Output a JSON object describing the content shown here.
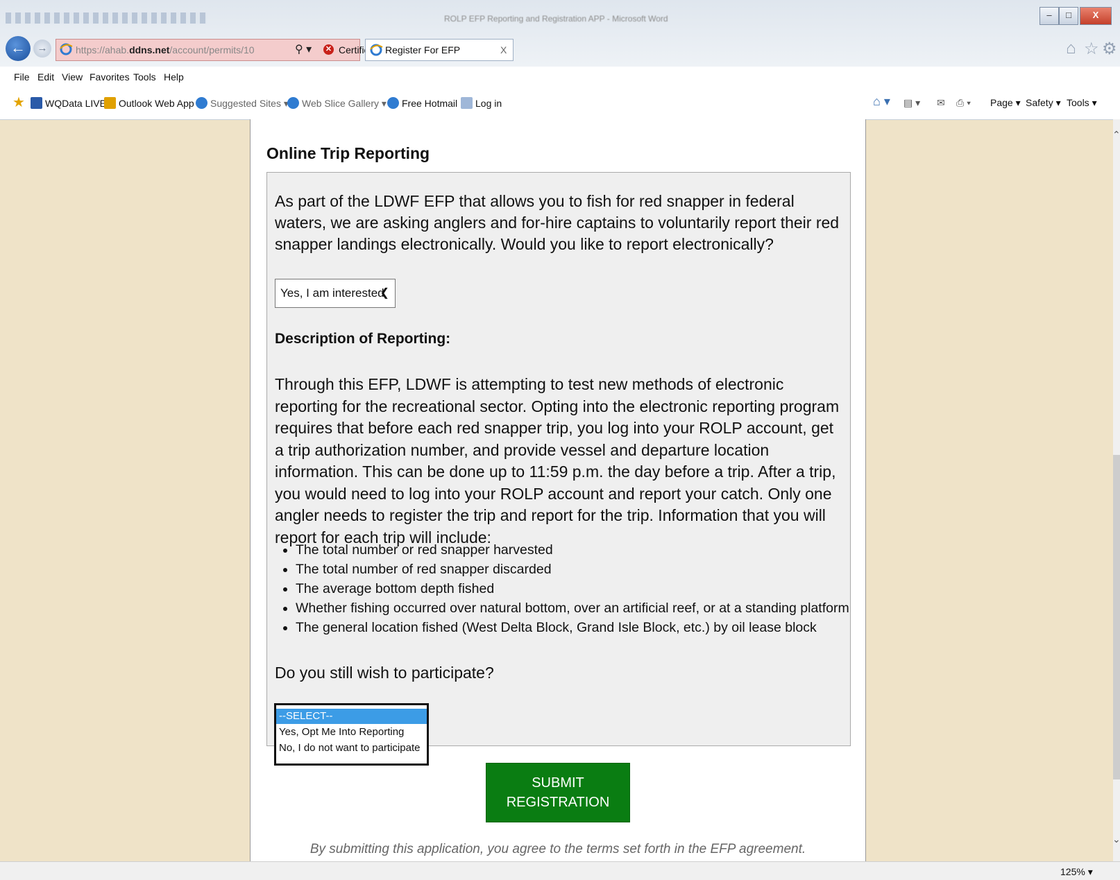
{
  "window": {
    "doc_title": "ROLP EFP Reporting and Registration APP - Microsoft Word",
    "min": "–",
    "max": "□",
    "close": "X"
  },
  "address_bar": {
    "url_prefix": "https://ahab.",
    "url_domain": "ddns.net",
    "url_path": "/account/permits/10",
    "search_icon": "⚲ ▾",
    "cert_error": "Certificate error",
    "refresh_icon": "↻"
  },
  "tab": {
    "title": "Register For EFP",
    "close": "X"
  },
  "menu": [
    "File",
    "Edit",
    "View",
    "Favorites",
    "Tools",
    "Help"
  ],
  "favorites": [
    {
      "label": "WQData LIVE",
      "color": "#2a5aa8"
    },
    {
      "label": "Outlook Web App",
      "color": "#e0a000"
    },
    {
      "label": "Suggested Sites ▾",
      "color": "#2f7bd1"
    },
    {
      "label": "Web Slice Gallery ▾",
      "color": "#2f7bd1"
    },
    {
      "label": "Free Hotmail",
      "color": "#2f7bd1"
    },
    {
      "label": "Log in",
      "color": "#9fb7d8"
    }
  ],
  "commands": {
    "page": "Page ▾",
    "safety": "Safety ▾",
    "tools": "Tools ▾"
  },
  "page": {
    "section_title": "Online Trip Reporting",
    "intro": "As part of the LDWF EFP that allows you to fish for red snapper in federal waters, we are asking anglers and for-hire captains to voluntarily report their red snapper landings electronically. Would you like to report electronically?",
    "interest_select": "Yes, I am interested",
    "desc_heading": "Description of Reporting:",
    "description": "Through this EFP, LDWF is attempting to test new methods of electronic reporting for the recreational sector. Opting into the electronic reporting program requires that before each red snapper trip, you log into your ROLP account, get a trip authorization number, and provide vessel and departure location information. This can be done up to 11:59 p.m. the day before a trip. After a trip, you would need to log into your ROLP account and report your catch. Only one angler needs to register the trip and report for the trip. Information that you will report for each trip will include:",
    "bullets": [
      "The total number or red snapper harvested",
      "The total number of red snapper discarded",
      "The average bottom depth fished",
      "Whether fishing occurred over natural bottom, over an artificial reef, or at a standing platform",
      "The general location fished (West Delta Block, Grand Isle Block, etc.) by oil lease block"
    ],
    "question": "Do you still wish to participate?",
    "participate_options": [
      "--SELECT--",
      "Yes, Opt Me Into Reporting",
      "No, I do not want to participate"
    ],
    "submit": "SUBMIT REGISTRATION",
    "terms": "By submitting this application, you agree to the terms set forth in the EFP agreement."
  },
  "status": {
    "zoom": "125%  ▾"
  }
}
